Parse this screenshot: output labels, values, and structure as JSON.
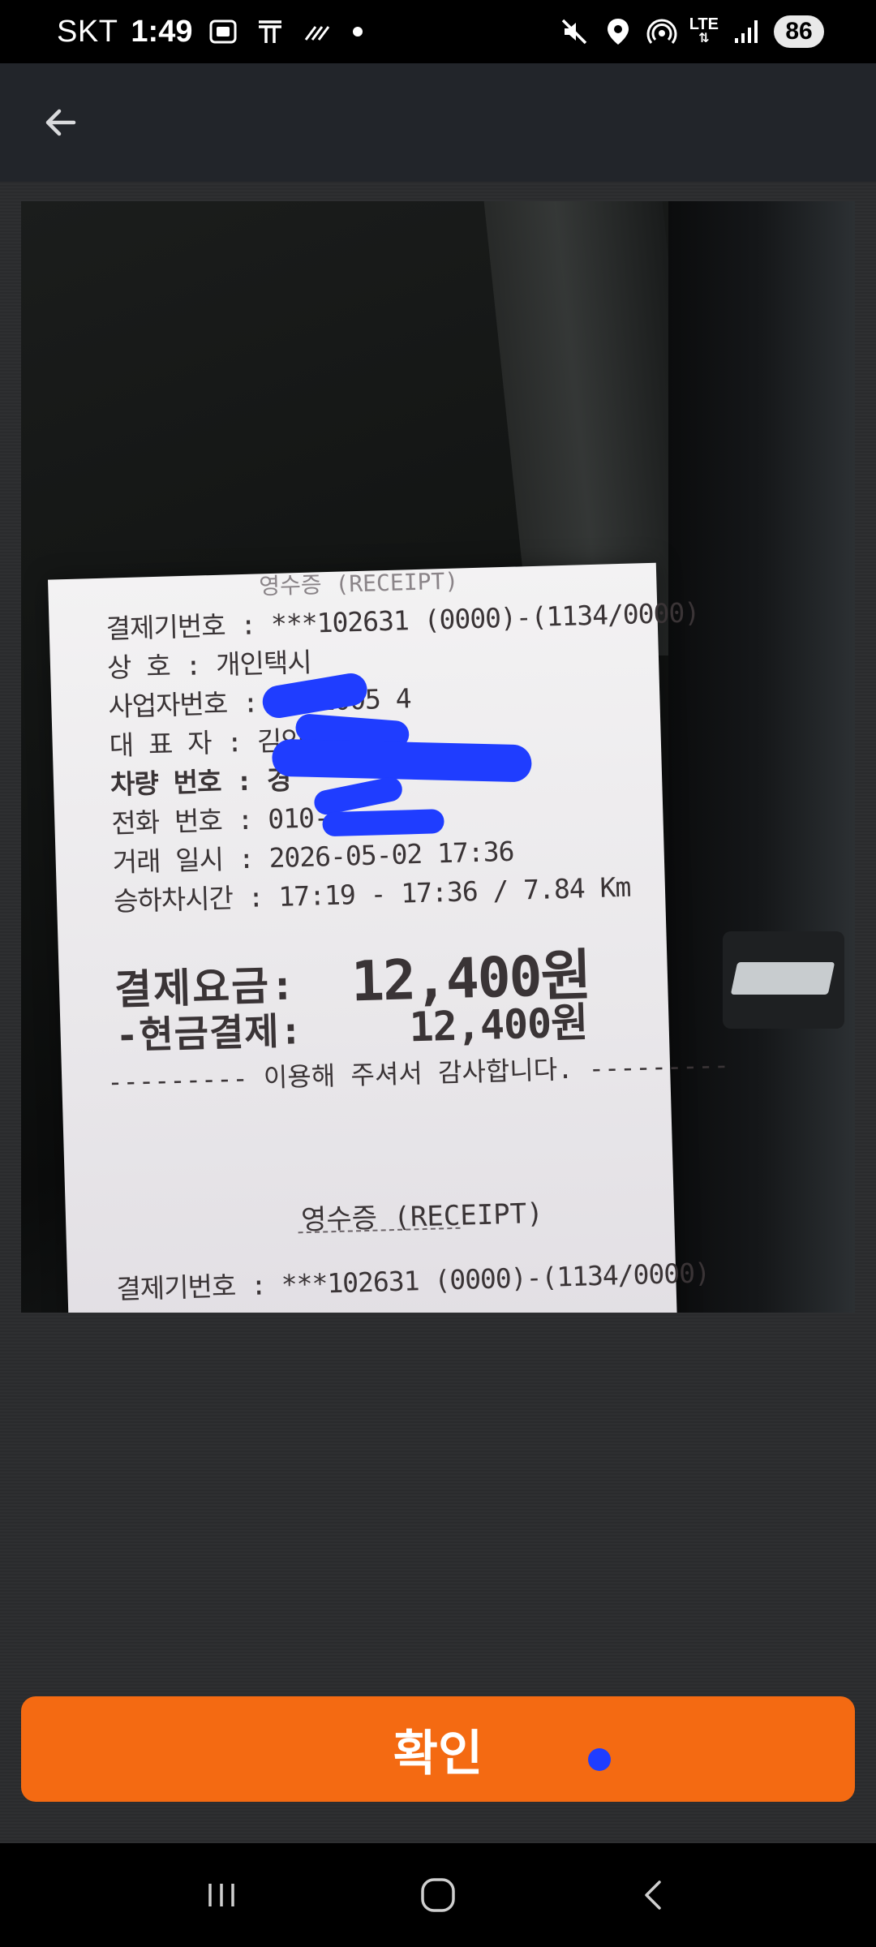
{
  "status_bar": {
    "carrier": "SKT",
    "time": "1:49",
    "lte": "LTE",
    "battery": "86",
    "icons": [
      "screenshot-icon",
      "t-app-icon",
      "data-saver-icon",
      "dot-icon",
      "mute-icon",
      "location-icon",
      "hotspot-icon",
      "signal-icon"
    ]
  },
  "app_bar": {
    "back_icon": "arrow-left-icon"
  },
  "receipt": {
    "top_partial": "영수증 (RECEIPT)",
    "rows": [
      "결제기번호 : ***102631 (0000)-(1134/0000)",
      "상      호 : 개인택시",
      "사업자번호 : 1191005 4",
      "대 표 자 : 김인",
      "차량 번호 : 경",
      "전화 번호 : 010-6",
      "거래 일시 : 2026-05-02 17:36",
      "승하차시간 : 17:19 - 17:36 / 7.84 Km"
    ],
    "payment_label": "결제요금:",
    "payment_amount": "12,400원",
    "cash_label": "-현금결제:",
    "cash_amount": "12,400원",
    "thanks": "--------- 이용해 주셔서 감사합니다. ---------",
    "receipt_title": "영수증 (RECEIPT)",
    "bottom_row": "결제기번호 : ***102631 (0000)-(1134/0000)"
  },
  "confirm_button": {
    "label": "확인"
  },
  "nav_bar": {
    "icons": [
      "recent-apps-icon",
      "home-icon",
      "back-nav-icon"
    ]
  }
}
